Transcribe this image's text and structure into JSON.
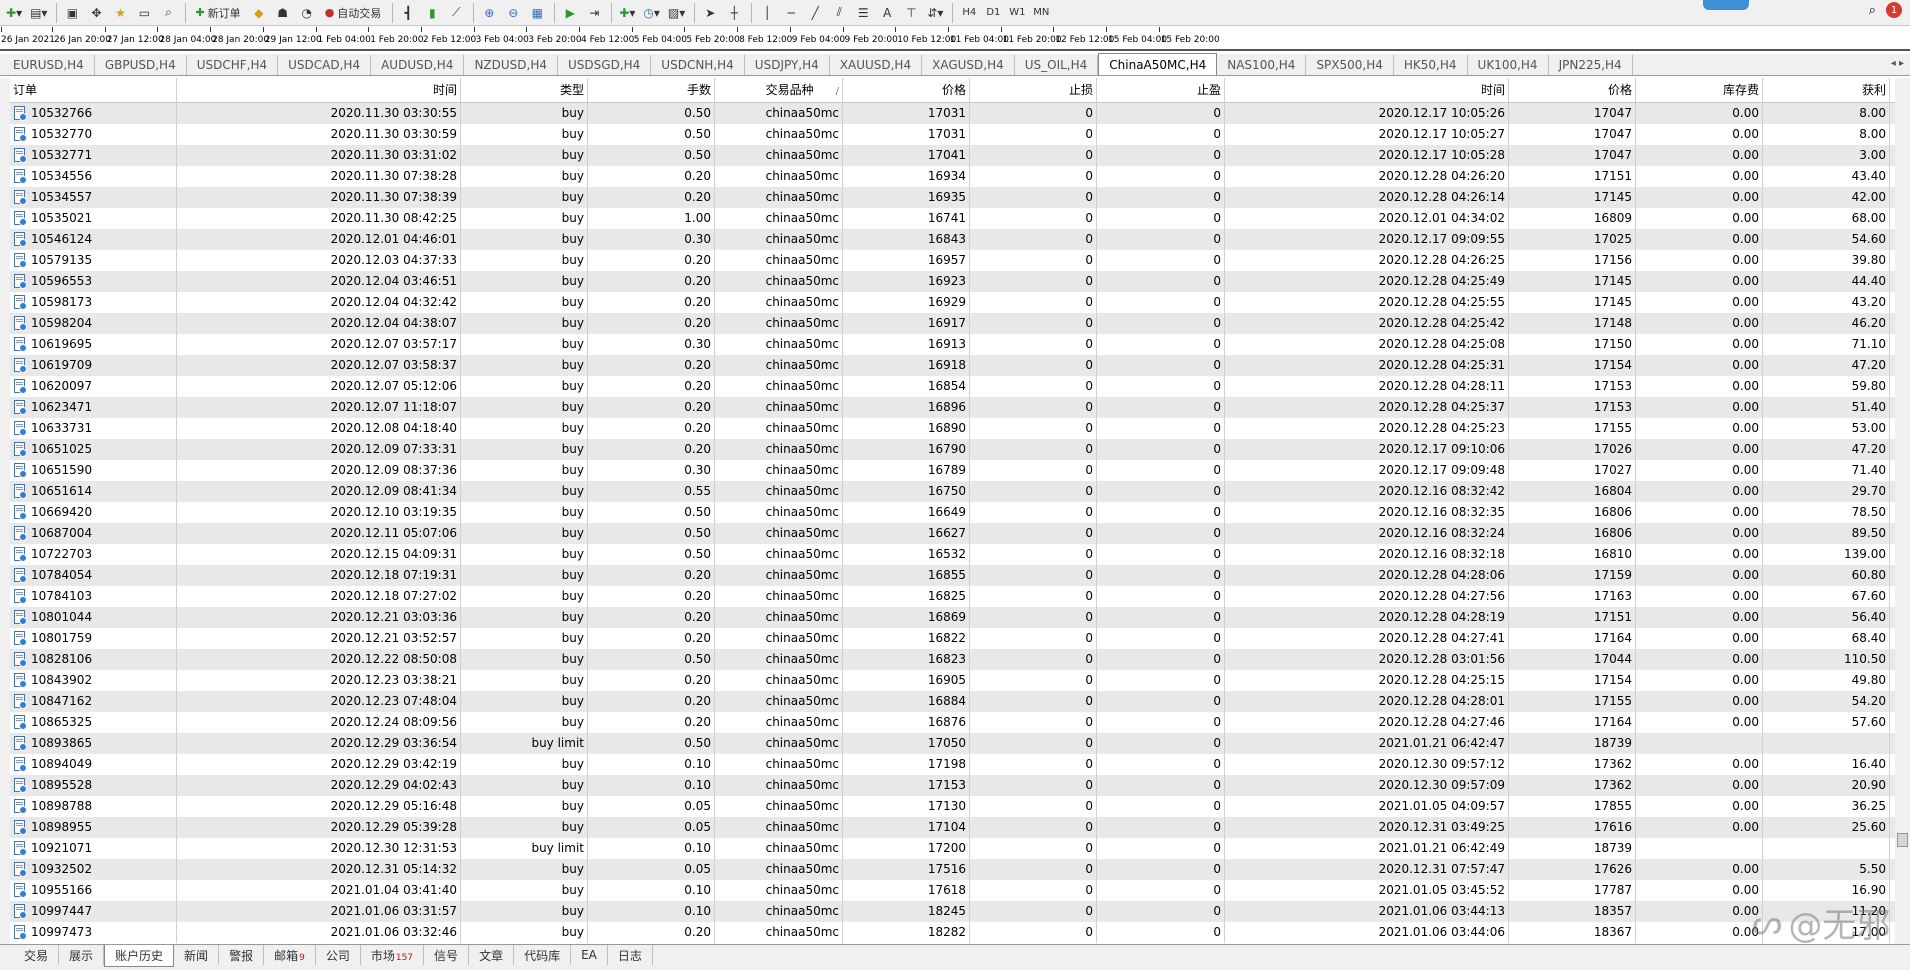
{
  "toolbar": {
    "new_order_label": "新订单",
    "auto_trading_label": "自动交易",
    "timeframes": [
      "H4",
      "D1",
      "W1",
      "MN"
    ],
    "badge_count": "1"
  },
  "time_axis": {
    "labels": [
      "26 Jan 2021",
      "26 Jan 20:00",
      "27 Jan 12:00",
      "28 Jan 04:00",
      "28 Jan 20:00",
      "29 Jan 12:00",
      "1 Feb 04:00",
      "1 Feb 20:00",
      "2 Feb 12:00",
      "3 Feb 04:00",
      "3 Feb 20:00",
      "4 Feb 12:00",
      "5 Feb 04:00",
      "5 Feb 20:00",
      "8 Feb 12:00",
      "9 Feb 04:00",
      "9 Feb 20:00",
      "10 Feb 12:00",
      "11 Feb 04:00",
      "11 Feb 20:00",
      "12 Feb 12:00",
      "15 Feb 04:00",
      "15 Feb 20:00"
    ]
  },
  "chart_tabs": {
    "items": [
      "EURUSD,H4",
      "GBPUSD,H4",
      "USDCHF,H4",
      "USDCAD,H4",
      "AUDUSD,H4",
      "NZDUSD,H4",
      "USDSGD,H4",
      "USDCNH,H4",
      "USDJPY,H4",
      "XAUUSD,H4",
      "XAGUSD,H4",
      "US_OIL,H4",
      "ChinaA50MC,H4",
      "NAS100,H4",
      "SPX500,H4",
      "HK50,H4",
      "UK100,H4",
      "JPN225,H4"
    ],
    "active_index": 12
  },
  "table": {
    "columns": [
      "订单",
      "时间",
      "类型",
      "手数",
      "交易品种",
      "价格",
      "止损",
      "止盈",
      "时间",
      "价格",
      "库存费",
      "获利"
    ],
    "sort_indicator": "/",
    "rows": [
      [
        "10532766",
        "2020.11.30 03:30:55",
        "buy",
        "0.50",
        "chinaa50mc",
        "17031",
        "0",
        "0",
        "2020.12.17 10:05:26",
        "17047",
        "0.00",
        "8.00"
      ],
      [
        "10532770",
        "2020.11.30 03:30:59",
        "buy",
        "0.50",
        "chinaa50mc",
        "17031",
        "0",
        "0",
        "2020.12.17 10:05:27",
        "17047",
        "0.00",
        "8.00"
      ],
      [
        "10532771",
        "2020.11.30 03:31:02",
        "buy",
        "0.50",
        "chinaa50mc",
        "17041",
        "0",
        "0",
        "2020.12.17 10:05:28",
        "17047",
        "0.00",
        "3.00"
      ],
      [
        "10534556",
        "2020.11.30 07:38:28",
        "buy",
        "0.20",
        "chinaa50mc",
        "16934",
        "0",
        "0",
        "2020.12.28 04:26:20",
        "17151",
        "0.00",
        "43.40"
      ],
      [
        "10534557",
        "2020.11.30 07:38:39",
        "buy",
        "0.20",
        "chinaa50mc",
        "16935",
        "0",
        "0",
        "2020.12.28 04:26:14",
        "17145",
        "0.00",
        "42.00"
      ],
      [
        "10535021",
        "2020.11.30 08:42:25",
        "buy",
        "1.00",
        "chinaa50mc",
        "16741",
        "0",
        "0",
        "2020.12.01 04:34:02",
        "16809",
        "0.00",
        "68.00"
      ],
      [
        "10546124",
        "2020.12.01 04:46:01",
        "buy",
        "0.30",
        "chinaa50mc",
        "16843",
        "0",
        "0",
        "2020.12.17 09:09:55",
        "17025",
        "0.00",
        "54.60"
      ],
      [
        "10579135",
        "2020.12.03 04:37:33",
        "buy",
        "0.20",
        "chinaa50mc",
        "16957",
        "0",
        "0",
        "2020.12.28 04:26:25",
        "17156",
        "0.00",
        "39.80"
      ],
      [
        "10596553",
        "2020.12.04 03:46:51",
        "buy",
        "0.20",
        "chinaa50mc",
        "16923",
        "0",
        "0",
        "2020.12.28 04:25:49",
        "17145",
        "0.00",
        "44.40"
      ],
      [
        "10598173",
        "2020.12.04 04:32:42",
        "buy",
        "0.20",
        "chinaa50mc",
        "16929",
        "0",
        "0",
        "2020.12.28 04:25:55",
        "17145",
        "0.00",
        "43.20"
      ],
      [
        "10598204",
        "2020.12.04 04:38:07",
        "buy",
        "0.20",
        "chinaa50mc",
        "16917",
        "0",
        "0",
        "2020.12.28 04:25:42",
        "17148",
        "0.00",
        "46.20"
      ],
      [
        "10619695",
        "2020.12.07 03:57:17",
        "buy",
        "0.30",
        "chinaa50mc",
        "16913",
        "0",
        "0",
        "2020.12.28 04:25:08",
        "17150",
        "0.00",
        "71.10"
      ],
      [
        "10619709",
        "2020.12.07 03:58:37",
        "buy",
        "0.20",
        "chinaa50mc",
        "16918",
        "0",
        "0",
        "2020.12.28 04:25:31",
        "17154",
        "0.00",
        "47.20"
      ],
      [
        "10620097",
        "2020.12.07 05:12:06",
        "buy",
        "0.20",
        "chinaa50mc",
        "16854",
        "0",
        "0",
        "2020.12.28 04:28:11",
        "17153",
        "0.00",
        "59.80"
      ],
      [
        "10623471",
        "2020.12.07 11:18:07",
        "buy",
        "0.20",
        "chinaa50mc",
        "16896",
        "0",
        "0",
        "2020.12.28 04:25:37",
        "17153",
        "0.00",
        "51.40"
      ],
      [
        "10633731",
        "2020.12.08 04:18:40",
        "buy",
        "0.20",
        "chinaa50mc",
        "16890",
        "0",
        "0",
        "2020.12.28 04:25:23",
        "17155",
        "0.00",
        "53.00"
      ],
      [
        "10651025",
        "2020.12.09 07:33:31",
        "buy",
        "0.20",
        "chinaa50mc",
        "16790",
        "0",
        "0",
        "2020.12.17 09:10:06",
        "17026",
        "0.00",
        "47.20"
      ],
      [
        "10651590",
        "2020.12.09 08:37:36",
        "buy",
        "0.30",
        "chinaa50mc",
        "16789",
        "0",
        "0",
        "2020.12.17 09:09:48",
        "17027",
        "0.00",
        "71.40"
      ],
      [
        "10651614",
        "2020.12.09 08:41:34",
        "buy",
        "0.55",
        "chinaa50mc",
        "16750",
        "0",
        "0",
        "2020.12.16 08:32:42",
        "16804",
        "0.00",
        "29.70"
      ],
      [
        "10669420",
        "2020.12.10 03:19:35",
        "buy",
        "0.50",
        "chinaa50mc",
        "16649",
        "0",
        "0",
        "2020.12.16 08:32:35",
        "16806",
        "0.00",
        "78.50"
      ],
      [
        "10687004",
        "2020.12.11 05:07:06",
        "buy",
        "0.50",
        "chinaa50mc",
        "16627",
        "0",
        "0",
        "2020.12.16 08:32:24",
        "16806",
        "0.00",
        "89.50"
      ],
      [
        "10722703",
        "2020.12.15 04:09:31",
        "buy",
        "0.50",
        "chinaa50mc",
        "16532",
        "0",
        "0",
        "2020.12.16 08:32:18",
        "16810",
        "0.00",
        "139.00"
      ],
      [
        "10784054",
        "2020.12.18 07:19:31",
        "buy",
        "0.20",
        "chinaa50mc",
        "16855",
        "0",
        "0",
        "2020.12.28 04:28:06",
        "17159",
        "0.00",
        "60.80"
      ],
      [
        "10784103",
        "2020.12.18 07:27:02",
        "buy",
        "0.20",
        "chinaa50mc",
        "16825",
        "0",
        "0",
        "2020.12.28 04:27:56",
        "17163",
        "0.00",
        "67.60"
      ],
      [
        "10801044",
        "2020.12.21 03:03:36",
        "buy",
        "0.20",
        "chinaa50mc",
        "16869",
        "0",
        "0",
        "2020.12.28 04:28:19",
        "17151",
        "0.00",
        "56.40"
      ],
      [
        "10801759",
        "2020.12.21 03:52:57",
        "buy",
        "0.20",
        "chinaa50mc",
        "16822",
        "0",
        "0",
        "2020.12.28 04:27:41",
        "17164",
        "0.00",
        "68.40"
      ],
      [
        "10828106",
        "2020.12.22 08:50:08",
        "buy",
        "0.50",
        "chinaa50mc",
        "16823",
        "0",
        "0",
        "2020.12.28 03:01:56",
        "17044",
        "0.00",
        "110.50"
      ],
      [
        "10843902",
        "2020.12.23 03:38:21",
        "buy",
        "0.20",
        "chinaa50mc",
        "16905",
        "0",
        "0",
        "2020.12.28 04:25:15",
        "17154",
        "0.00",
        "49.80"
      ],
      [
        "10847162",
        "2020.12.23 07:48:04",
        "buy",
        "0.20",
        "chinaa50mc",
        "16884",
        "0",
        "0",
        "2020.12.28 04:28:01",
        "17155",
        "0.00",
        "54.20"
      ],
      [
        "10865325",
        "2020.12.24 08:09:56",
        "buy",
        "0.20",
        "chinaa50mc",
        "16876",
        "0",
        "0",
        "2020.12.28 04:27:46",
        "17164",
        "0.00",
        "57.60"
      ],
      [
        "10893865",
        "2020.12.29 03:36:54",
        "buy limit",
        "0.50",
        "chinaa50mc",
        "17050",
        "0",
        "0",
        "2021.01.21 06:42:47",
        "18739",
        "",
        ""
      ],
      [
        "10894049",
        "2020.12.29 03:42:19",
        "buy",
        "0.10",
        "chinaa50mc",
        "17198",
        "0",
        "0",
        "2020.12.30 09:57:12",
        "17362",
        "0.00",
        "16.40"
      ],
      [
        "10895528",
        "2020.12.29 04:02:43",
        "buy",
        "0.10",
        "chinaa50mc",
        "17153",
        "0",
        "0",
        "2020.12.30 09:57:09",
        "17362",
        "0.00",
        "20.90"
      ],
      [
        "10898788",
        "2020.12.29 05:16:48",
        "buy",
        "0.05",
        "chinaa50mc",
        "17130",
        "0",
        "0",
        "2021.01.05 04:09:57",
        "17855",
        "0.00",
        "36.25"
      ],
      [
        "10898955",
        "2020.12.29 05:39:28",
        "buy",
        "0.05",
        "chinaa50mc",
        "17104",
        "0",
        "0",
        "2020.12.31 03:49:25",
        "17616",
        "0.00",
        "25.60"
      ],
      [
        "10921071",
        "2020.12.30 12:31:53",
        "buy limit",
        "0.10",
        "chinaa50mc",
        "17200",
        "0",
        "0",
        "2021.01.21 06:42:49",
        "18739",
        "",
        ""
      ],
      [
        "10932502",
        "2020.12.31 05:14:32",
        "buy",
        "0.05",
        "chinaa50mc",
        "17516",
        "0",
        "0",
        "2020.12.31 07:57:47",
        "17626",
        "0.00",
        "5.50"
      ],
      [
        "10955166",
        "2021.01.04 03:41:40",
        "buy",
        "0.10",
        "chinaa50mc",
        "17618",
        "0",
        "0",
        "2021.01.05 03:45:52",
        "17787",
        "0.00",
        "16.90"
      ],
      [
        "10997447",
        "2021.01.06 03:31:57",
        "buy",
        "0.10",
        "chinaa50mc",
        "18245",
        "0",
        "0",
        "2021.01.06 03:44:13",
        "18357",
        "0.00",
        "11.20"
      ],
      [
        "10997473",
        "2021.01.06 03:32:46",
        "buy",
        "0.20",
        "chinaa50mc",
        "18282",
        "0",
        "0",
        "2021.01.06 03:44:06",
        "18367",
        "0.00",
        "17.00"
      ]
    ]
  },
  "watermark": {
    "text": "@无邪"
  },
  "bottom_tabs": {
    "items": [
      {
        "label": "交易",
        "badge": ""
      },
      {
        "label": "展示",
        "badge": ""
      },
      {
        "label": "账户历史",
        "badge": ""
      },
      {
        "label": "新闻",
        "badge": ""
      },
      {
        "label": "警报",
        "badge": ""
      },
      {
        "label": "邮箱",
        "badge": "9"
      },
      {
        "label": "公司",
        "badge": ""
      },
      {
        "label": "市场",
        "badge": "157"
      },
      {
        "label": "信号",
        "badge": ""
      },
      {
        "label": "文章",
        "badge": ""
      },
      {
        "label": "代码库",
        "badge": ""
      },
      {
        "label": "EA",
        "badge": ""
      },
      {
        "label": "日志",
        "badge": ""
      }
    ],
    "active_index": 2
  }
}
